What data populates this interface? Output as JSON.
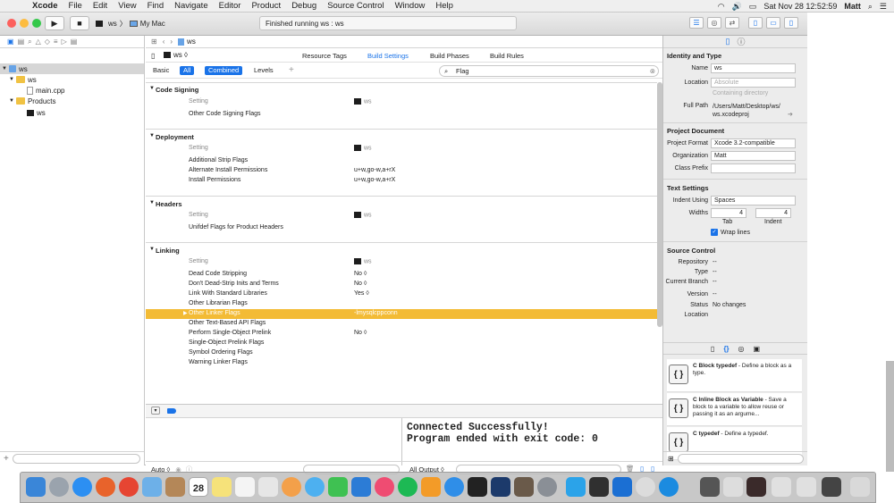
{
  "menubar": {
    "app": "Xcode",
    "items": [
      "File",
      "Edit",
      "View",
      "Find",
      "Navigate",
      "Editor",
      "Product",
      "Debug",
      "Source Control",
      "Window",
      "Help"
    ],
    "clock": "Sat Nov 28  12:52:59",
    "user": "Matt"
  },
  "toolbar": {
    "scheme": "ws",
    "destination": "My Mac",
    "activity": "Finished running ws : ws"
  },
  "navigator": {
    "items": [
      {
        "label": "ws",
        "kind": "project"
      },
      {
        "label": "ws",
        "kind": "folder"
      },
      {
        "label": "main.cpp",
        "kind": "file"
      },
      {
        "label": "Products",
        "kind": "folder"
      },
      {
        "label": "ws",
        "kind": "product"
      }
    ]
  },
  "editor": {
    "breadcrumb": "ws",
    "target": "ws",
    "tabs": [
      "Resource Tags",
      "Build Settings",
      "Build Phases",
      "Build Rules"
    ],
    "active_tab": "Build Settings",
    "filters": [
      "Basic",
      "All",
      "Combined",
      "Levels"
    ],
    "search_value": "Flag",
    "column_setting": "Setting",
    "column_target": "ws",
    "sections": [
      {
        "title": "Code Signing",
        "rows": [
          {
            "label": "Other Code Signing Flags",
            "value": ""
          }
        ]
      },
      {
        "title": "Deployment",
        "rows": [
          {
            "label": "Additional Strip Flags",
            "value": ""
          },
          {
            "label": "Alternate Install Permissions",
            "value": "u+w,go-w,a+rX"
          },
          {
            "label": "Install Permissions",
            "value": "u+w,go-w,a+rX"
          }
        ]
      },
      {
        "title": "Headers",
        "rows": [
          {
            "label": "Unifdef Flags for Product Headers",
            "value": ""
          }
        ]
      },
      {
        "title": "Linking",
        "rows": [
          {
            "label": "Dead Code Stripping",
            "value": "No ◊"
          },
          {
            "label": "Don't Dead-Strip Inits and Terms",
            "value": "No ◊"
          },
          {
            "label": "Link With Standard Libraries",
            "value": "Yes ◊"
          },
          {
            "label": "Other Librarian Flags",
            "value": ""
          },
          {
            "label": "Other Linker Flags",
            "value": "-lmysqlcppconn"
          },
          {
            "label": "Other Text-Based API Flags",
            "value": ""
          },
          {
            "label": "Perform Single-Object Prelink",
            "value": "No ◊"
          },
          {
            "label": "Single-Object Prelink Flags",
            "value": ""
          },
          {
            "label": "Symbol Ordering Flags",
            "value": ""
          },
          {
            "label": "Warning Linker Flags",
            "value": ""
          }
        ]
      }
    ]
  },
  "debug": {
    "auto_label": "Auto ◊",
    "output_label": "All Output ◊",
    "console_lines": "Connected Successfully!\nProgram ended with exit code: 0"
  },
  "inspector": {
    "identity_title": "Identity and Type",
    "name_label": "Name",
    "name_value": "ws",
    "location_label": "Location",
    "location_value": "Absolute",
    "containing": "Containing directory",
    "fullpath_label": "Full Path",
    "fullpath_value": "/Users/Matt/Desktop/ws/ ws.xcodeproj",
    "project_doc_title": "Project Document",
    "format_label": "Project Format",
    "format_value": "Xcode 3.2-compatible",
    "org_label": "Organization",
    "org_value": "Matt",
    "prefix_label": "Class Prefix",
    "text_settings_title": "Text Settings",
    "indent_label": "Indent Using",
    "indent_value": "Spaces",
    "widths_label": "Widths",
    "tab_width": "4",
    "indent_width": "4",
    "tab_label": "Tab",
    "indent_sub_label": "Indent",
    "wrap_label": "Wrap lines",
    "source_control_title": "Source Control",
    "sc_rows": [
      {
        "label": "Repository",
        "value": "--"
      },
      {
        "label": "Type",
        "value": "--"
      },
      {
        "label": "Current Branch",
        "value": "--"
      },
      {
        "label": "Version",
        "value": "--"
      },
      {
        "label": "Status",
        "value": "No changes"
      },
      {
        "label": "Location",
        "value": ""
      }
    ],
    "library": [
      {
        "title": "C Block typedef",
        "desc": " - Define a block as a type."
      },
      {
        "title": "C Inline Block as Variable",
        "desc": " - Save a block to a variable to allow reuse or passing it as an argume..."
      },
      {
        "title": "C typedef",
        "desc": " - Define a typedef."
      }
    ]
  },
  "dock_calendar": "28"
}
